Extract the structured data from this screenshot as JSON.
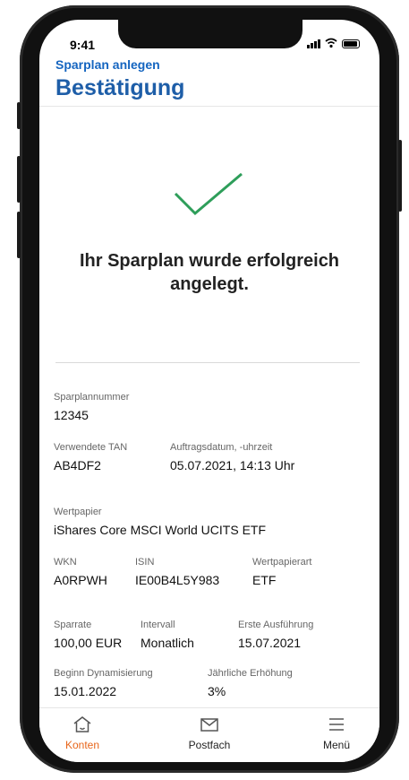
{
  "status": {
    "time": "9:41"
  },
  "header": {
    "breadcrumb": "Sparplan anlegen",
    "title": "Bestätigung"
  },
  "success": {
    "line1": "Ihr Sparplan wurde erfolgreich",
    "line2": "angelegt."
  },
  "details": {
    "sparplannummer": {
      "label": "Sparplannummer",
      "value": "12345"
    },
    "tan": {
      "label": "Verwendete TAN",
      "value": "AB4DF2"
    },
    "auftragsdatum": {
      "label": "Auftragsdatum, -uhrzeit",
      "value": "05.07.2021, 14:13 Uhr"
    },
    "wertpapier": {
      "label": "Wertpapier",
      "value": "iShares Core MSCI World UCITS ETF"
    },
    "wkn": {
      "label": "WKN",
      "value": "A0RPWH"
    },
    "isin": {
      "label": "ISIN",
      "value": "IE00B4L5Y983"
    },
    "wertpapierart": {
      "label": "Wertpapierart",
      "value": "ETF"
    },
    "sparrate": {
      "label": "Sparrate",
      "value": "100,00 EUR"
    },
    "intervall": {
      "label": "Intervall",
      "value": "Monatlich"
    },
    "erste_ausfuehrung": {
      "label": "Erste Ausführung",
      "value": "15.07.2021"
    },
    "beginn_dynamisierung": {
      "label": "Beginn Dynamisierung",
      "value": "15.01.2022"
    },
    "jaehrliche_erhoehung": {
      "label": "Jährliche Erhöhung",
      "value": "3%"
    }
  },
  "tabbar": {
    "konten": {
      "label": "Konten",
      "icon": "home-icon",
      "active": true
    },
    "postfach": {
      "label": "Postfach",
      "icon": "mail-icon"
    },
    "menu": {
      "label": "Menü",
      "icon": "hamburger-menu-icon"
    }
  },
  "colors": {
    "accent_blue": "#1e5ea8",
    "success_green": "#2e9e5a",
    "active_tab": "#e8651a",
    "text": "#111111"
  }
}
